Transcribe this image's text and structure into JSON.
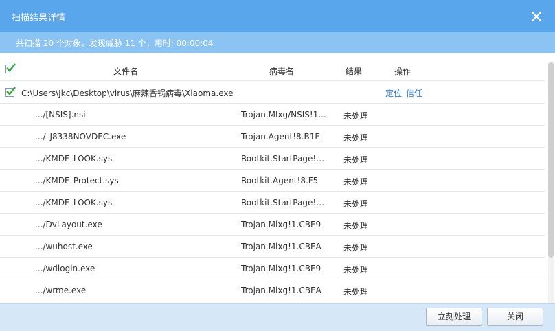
{
  "window": {
    "title": "扫描结果详情"
  },
  "summary": {
    "text": "共扫描 20 个对象，发现威胁 11 个，用时: 00:00:04"
  },
  "columns": {
    "file": "文件名",
    "virus": "病毒名",
    "result": "结果",
    "action": "操作"
  },
  "group": {
    "path": "C:\\Users\\Jkc\\Desktop\\virus\\麻辣香锅病毒\\Xiaoma.exe",
    "locate_label": "定位",
    "trust_label": "信任"
  },
  "rows": [
    {
      "file": ".../[NSIS].nsi",
      "virus": "Trojan.Mlxg/NSIS!1...",
      "result": "未处理"
    },
    {
      "file": ".../_J8338NOVDEC.exe",
      "virus": "Trojan.Agent!8.B1E",
      "result": "未处理"
    },
    {
      "file": ".../KMDF_LOOK.sys",
      "virus": "Rootkit.StartPage!1...",
      "result": "未处理"
    },
    {
      "file": ".../KMDF_Protect.sys",
      "virus": "Rootkit.Agent!8.F5",
      "result": "未处理"
    },
    {
      "file": ".../KMDF_LOOK.sys",
      "virus": "Rootkit.StartPage!1...",
      "result": "未处理"
    },
    {
      "file": ".../DvLayout.exe",
      "virus": "Trojan.Mlxg!1.CBE9",
      "result": "未处理"
    },
    {
      "file": ".../wuhost.exe",
      "virus": "Trojan.Mlxg!1.CBEA",
      "result": "未处理"
    },
    {
      "file": ".../wdlogin.exe",
      "virus": "Trojan.Mlxg!1.CBE9",
      "result": "未处理"
    },
    {
      "file": ".../wrme.exe",
      "virus": "Trojan.Mlxg!1.CBEA",
      "result": "未处理"
    }
  ],
  "footer": {
    "process_label": "立刻处理",
    "close_label": "关闭"
  },
  "colors": {
    "titlebar": "#5aa6ec",
    "summary": "#8bc3f3",
    "link": "#2f7bd2",
    "check": "#3aa63a"
  },
  "icons": {
    "close": "close-icon",
    "check": "checkmark-icon"
  }
}
